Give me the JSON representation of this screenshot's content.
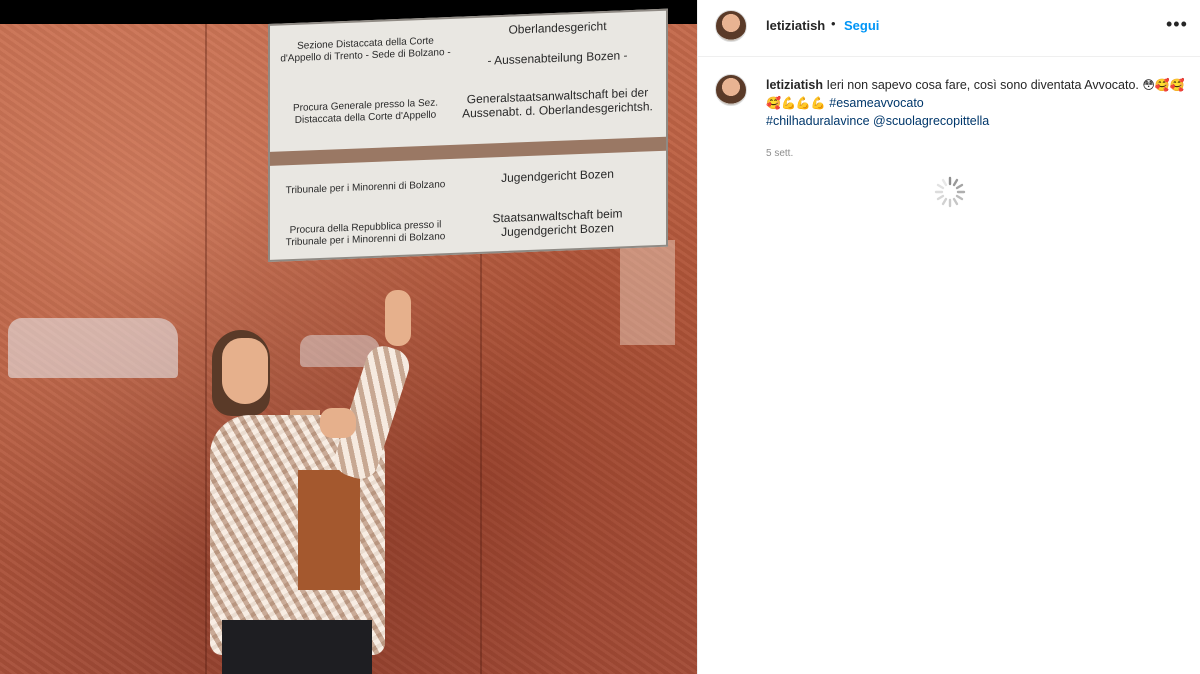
{
  "post": {
    "username": "letiziatish",
    "follow_label": "Segui",
    "separator": "•",
    "more_label": "•••"
  },
  "caption": {
    "username": "letiziatish",
    "text": " Ieri non sapevo cosa fare, così sono diventata Avvocato. ",
    "emojis": "😳🥰🥰🥰💪💪💪",
    "hashtag1": "#esameavvocato",
    "hashtag2": "#chilhaduralavince",
    "mention": "@scuolagrecopittella",
    "time": "5 sett."
  },
  "sign": {
    "row1_it": "Sezione Distaccata della Corte d'Appello di Trento - Sede di Bolzano -",
    "row1_de_a": "Oberlandesgericht",
    "row1_de_b": "- Aussenabteilung Bozen -",
    "row2_it": "Procura Generale presso la Sez. Distaccata della Corte d'Appello",
    "row2_de": "Generalstaatsanwaltschaft bei der Aussenabt. d. Oberlandesgerichtsh.",
    "row3_it": "Tribunale per i Minorenni di Bolzano",
    "row3_de": "Jugendgericht Bozen",
    "row4_it": "Procura della Repubblica presso il Tribunale per i Minorenni di Bolzano",
    "row4_de": "Staatsanwaltschaft beim Jugendgericht Bozen"
  },
  "colors": {
    "link_blue": "#0095f6",
    "hashtag_blue": "#00376b",
    "text": "#262626",
    "muted": "#8e8e8e"
  }
}
